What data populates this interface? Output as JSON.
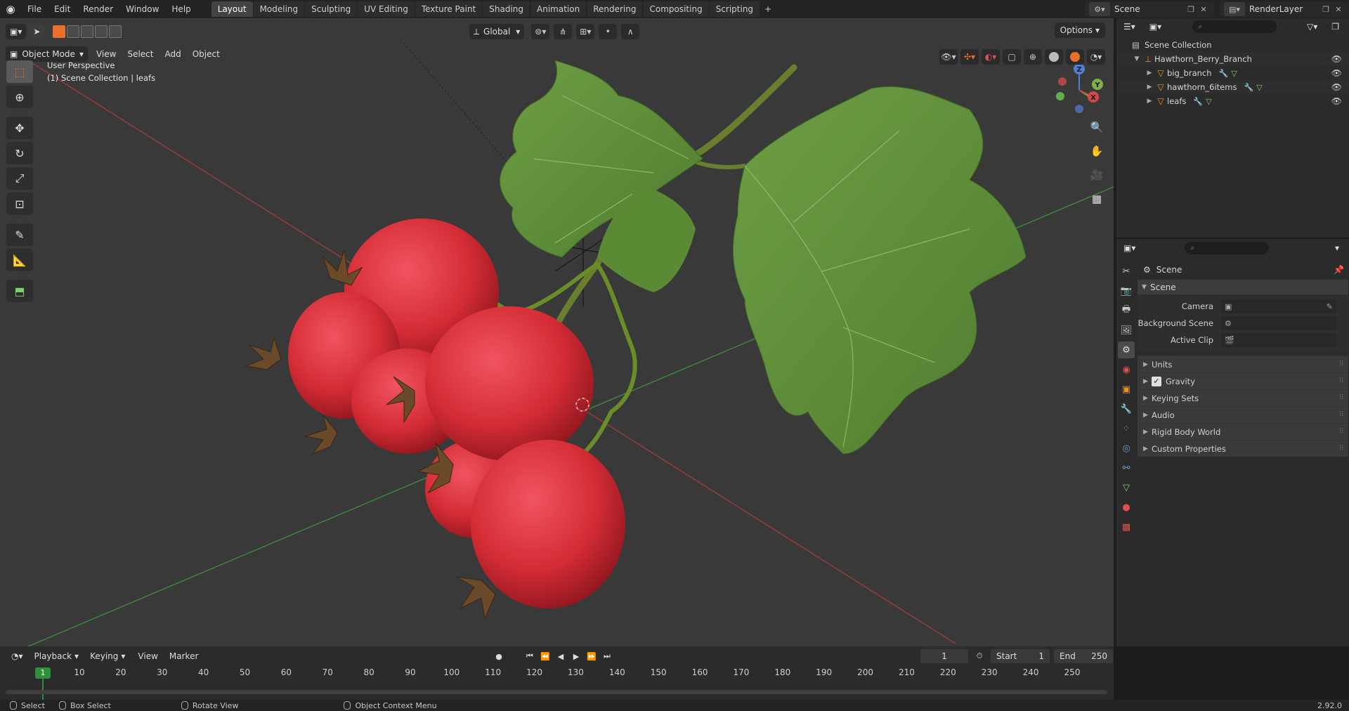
{
  "topbar": {
    "menus": [
      "File",
      "Edit",
      "Render",
      "Window",
      "Help"
    ],
    "workspaces": [
      "Layout",
      "Modeling",
      "Sculpting",
      "UV Editing",
      "Texture Paint",
      "Shading",
      "Animation",
      "Rendering",
      "Compositing",
      "Scripting"
    ],
    "active_workspace": "Layout",
    "add_tab": "+",
    "scene_name": "Scene",
    "view_layer": "RenderLayer"
  },
  "viewport": {
    "mode": "Object Mode",
    "menus": [
      "View",
      "Select",
      "Add",
      "Object"
    ],
    "transform_orientation": "Global",
    "options_label": "Options",
    "info_line1": "User Perspective",
    "info_line2": "(1) Scene Collection | leafs",
    "gizmo_axes": [
      "X",
      "Y",
      "Z"
    ]
  },
  "outliner": {
    "root": "Scene Collection",
    "items": [
      {
        "label": "Hawthorn_Berry_Branch",
        "level": 1
      },
      {
        "label": "big_branch",
        "level": 2
      },
      {
        "label": "hawthorn_6items",
        "level": 2
      },
      {
        "label": "leafs",
        "level": 2
      }
    ]
  },
  "properties": {
    "title": "Scene",
    "section": "Scene",
    "fields": [
      {
        "label": "Camera"
      },
      {
        "label": "Background Scene"
      },
      {
        "label": "Active Clip"
      }
    ],
    "collapsed_sections": [
      "Units",
      "Gravity",
      "Keying Sets",
      "Audio",
      "Rigid Body World",
      "Custom Properties"
    ],
    "gravity_checked": true
  },
  "timeline": {
    "menus": [
      "Playback",
      "Keying",
      "View",
      "Marker"
    ],
    "current_frame": "1",
    "start_label": "Start",
    "start_value": "1",
    "end_label": "End",
    "end_value": "250",
    "ruler_ticks": [
      "10",
      "20",
      "30",
      "40",
      "50",
      "60",
      "70",
      "80",
      "90",
      "100",
      "110",
      "120",
      "130",
      "140",
      "150",
      "160",
      "170",
      "180",
      "190",
      "200",
      "210",
      "220",
      "230",
      "240",
      "250"
    ],
    "ruler_current": "1"
  },
  "statusbar": {
    "items": [
      "Select",
      "Box Select",
      "Rotate View",
      "Object Context Menu"
    ],
    "version": "2.92.0"
  },
  "colors": {
    "accent": "#e8702a",
    "berry": "#d42c35",
    "leaf": "#5f8f3a",
    "x_axis": "#c0403f",
    "y_axis": "#5d9e3a"
  }
}
